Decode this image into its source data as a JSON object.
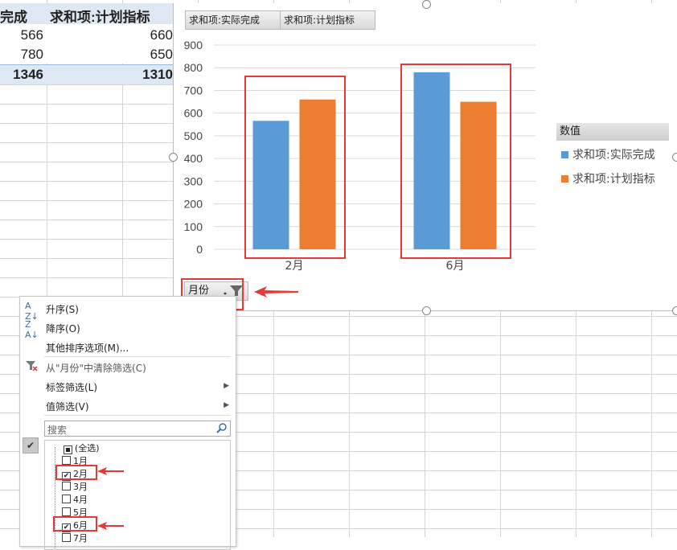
{
  "sheet": {
    "pivot": {
      "col_header_1": "完成",
      "col_header_2": "求和项:计划指标",
      "rows": [
        {
          "actual": "566",
          "plan": "660"
        },
        {
          "actual": "780",
          "plan": "650"
        }
      ],
      "total": {
        "actual": "1346",
        "plan": "1310"
      }
    }
  },
  "chart": {
    "value_field_buttons": [
      "求和项:实际完成",
      "求和项:计划指标"
    ],
    "axis_field_button": "月份",
    "legend_title": "数值",
    "legend_items": [
      {
        "label": "求和项:实际完成",
        "color": "#5b9bd5"
      },
      {
        "label": "求和项:计划指标",
        "color": "#ed7d31"
      }
    ]
  },
  "chart_data": {
    "type": "bar",
    "categories": [
      "2月",
      "6月"
    ],
    "series": [
      {
        "name": "求和项:实际完成",
        "values": [
          566,
          780
        ],
        "color": "#5b9bd5"
      },
      {
        "name": "求和项:计划指标",
        "values": [
          660,
          650
        ],
        "color": "#ed7d31"
      }
    ],
    "yticks": [
      "0",
      "100",
      "200",
      "300",
      "400",
      "500",
      "600",
      "700",
      "800",
      "900"
    ],
    "ylim": [
      0,
      900
    ],
    "grid": true,
    "legend": "right"
  },
  "menu": {
    "sort_asc": "升序(S)",
    "sort_desc": "降序(O)",
    "more_sort": "其他排序选项(M)...",
    "clear_filter": "从\"月份\"中清除筛选(C)",
    "label_filter": "标签筛选(L)",
    "value_filter": "值筛选(V)",
    "search_placeholder": "搜索",
    "list": [
      {
        "label": "(全选)",
        "state": "partial"
      },
      {
        "label": "1月",
        "state": "unchecked"
      },
      {
        "label": "2月",
        "state": "checked"
      },
      {
        "label": "3月",
        "state": "unchecked"
      },
      {
        "label": "4月",
        "state": "unchecked"
      },
      {
        "label": "5月",
        "state": "unchecked"
      },
      {
        "label": "6月",
        "state": "checked"
      },
      {
        "label": "7月",
        "state": "unchecked"
      }
    ]
  }
}
